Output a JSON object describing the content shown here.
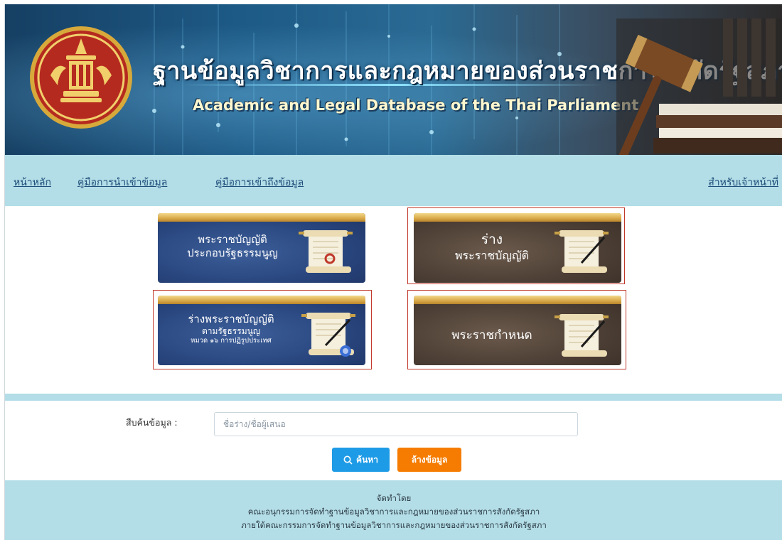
{
  "banner": {
    "title_th": "ฐานข้อมูลวิชาการและกฎหมายของส่วนราชการสังกัดรัฐสภา",
    "title_en": "Academic and Legal Database of the Thai Parliament"
  },
  "nav": {
    "home": "หน้าหลัก",
    "import_guide": "คู่มือการนำเข้าข้อมูล",
    "access_guide": "คู่มือการเข้าถึงข้อมูล",
    "staff": "สำหรับเจ้าหน้าที่"
  },
  "tiles": [
    {
      "line1": "พระราชบัญญัติ",
      "line2": "ประกอบรัฐธรรมนูญ",
      "theme": "blue"
    },
    {
      "line1": "ร่าง",
      "line2": "พระราชบัญญัติ",
      "theme": "brown"
    },
    {
      "line1": "ร่างพระราชบัญญัติ",
      "line2": "ตามรัฐธรรมนูญ",
      "line3": "หมวด ๑๖ การปฏิรูปประเทศ",
      "theme": "blue"
    },
    {
      "line1": "พระราชกำหนด",
      "theme": "brown"
    }
  ],
  "search": {
    "label": "สืบค้นข้อมูล :",
    "value": "",
    "placeholder": "ชื่อร่าง/ชื่อผู้เสนอ",
    "search_button": "ค้นหา",
    "clear_button": "ล้างข้อมูล"
  },
  "footer": {
    "line1": "จัดทำโดย",
    "line2": "คณะอนุกรรมการจัดทำฐานข้อมูลวิชาการและกฎหมายของส่วนราชการสังกัดรัฐสภา",
    "line3": "ภายใต้คณะกรรมการจัดทำฐานข้อมูลวิชาการและกฎหมายของส่วนราชการสังกัดรัฐสภา"
  },
  "colors": {
    "nav_bg": "#b3dde7",
    "link": "#1f4f7a",
    "search_btn": "#1e9be6",
    "clear_btn": "#f57c00",
    "tile_frame": "#c0392b"
  },
  "icons": [
    "parliament-seal-icon",
    "gavel-icon",
    "scroll-icon",
    "search-icon"
  ]
}
